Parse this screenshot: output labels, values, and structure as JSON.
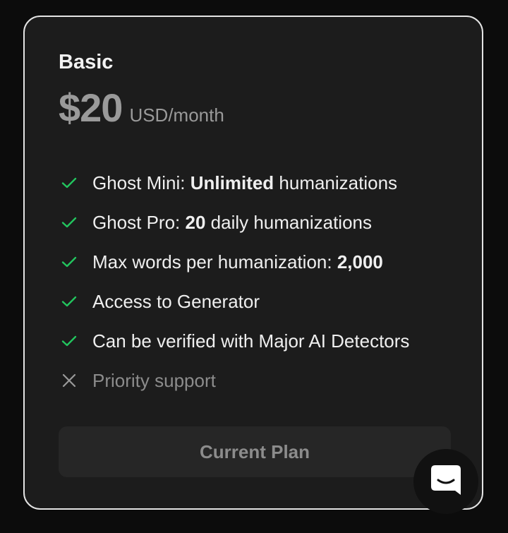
{
  "plan": {
    "name": "Basic",
    "price": "$20",
    "period": "USD/month"
  },
  "features": [
    {
      "included": true,
      "before": "Ghost Mini: ",
      "bold": "Unlimited",
      "after": " humanizations",
      "icon": "check-icon"
    },
    {
      "included": true,
      "before": "Ghost Pro: ",
      "bold": "20",
      "after": " daily humanizations",
      "icon": "check-icon"
    },
    {
      "included": true,
      "before": "Max words per humanization: ",
      "bold": "2,000",
      "after": "",
      "icon": "check-icon"
    },
    {
      "included": true,
      "before": "Access to Generator",
      "bold": "",
      "after": "",
      "icon": "check-icon"
    },
    {
      "included": true,
      "before": "Can be verified with Major AI Detectors",
      "bold": "",
      "after": "",
      "icon": "check-icon"
    },
    {
      "included": false,
      "before": "Priority support",
      "bold": "",
      "after": "",
      "icon": "x-icon"
    }
  ],
  "button": {
    "label": "Current Plan"
  },
  "chat": {
    "icon": "chat-bubble-icon"
  },
  "colors": {
    "check": "#22c55e",
    "x": "#9a9a9a"
  }
}
